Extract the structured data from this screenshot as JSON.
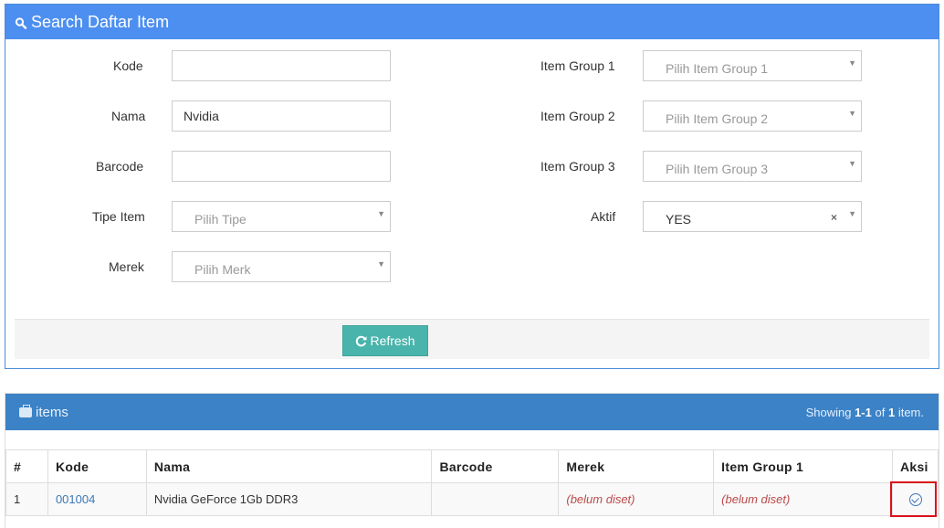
{
  "search": {
    "title": "Search Daftar Item",
    "fields": {
      "kode": {
        "label": "Kode",
        "value": ""
      },
      "nama": {
        "label": "Nama",
        "value": "Nvidia"
      },
      "barcode": {
        "label": "Barcode",
        "value": ""
      },
      "tipe_item": {
        "label": "Tipe Item",
        "placeholder": "Pilih Tipe"
      },
      "merek": {
        "label": "Merek",
        "placeholder": "Pilih Merk"
      },
      "item_group_1": {
        "label": "Item Group 1",
        "placeholder": "Pilih Item Group 1"
      },
      "item_group_2": {
        "label": "Item Group 2",
        "placeholder": "Pilih Item Group 2"
      },
      "item_group_3": {
        "label": "Item Group 3",
        "placeholder": "Pilih Item Group 3"
      },
      "aktif": {
        "label": "Aktif",
        "value": "YES",
        "clear": "×"
      }
    },
    "refresh_label": "Refresh",
    "caret": "▼"
  },
  "items": {
    "title": "items",
    "summary_prefix": "Showing",
    "summary_range": "1-1",
    "summary_of": "of",
    "summary_total": "1",
    "summary_suffix": "item.",
    "columns": [
      "#",
      "Kode",
      "Nama",
      "Barcode",
      "Merek",
      "Item Group 1",
      "Aksi"
    ],
    "rows": [
      {
        "num": "1",
        "kode": "001004",
        "nama": "Nvidia GeForce 1Gb DDR3",
        "barcode": "",
        "merek": "(belum diset)",
        "item_group_1": "(belum diset)"
      }
    ]
  }
}
